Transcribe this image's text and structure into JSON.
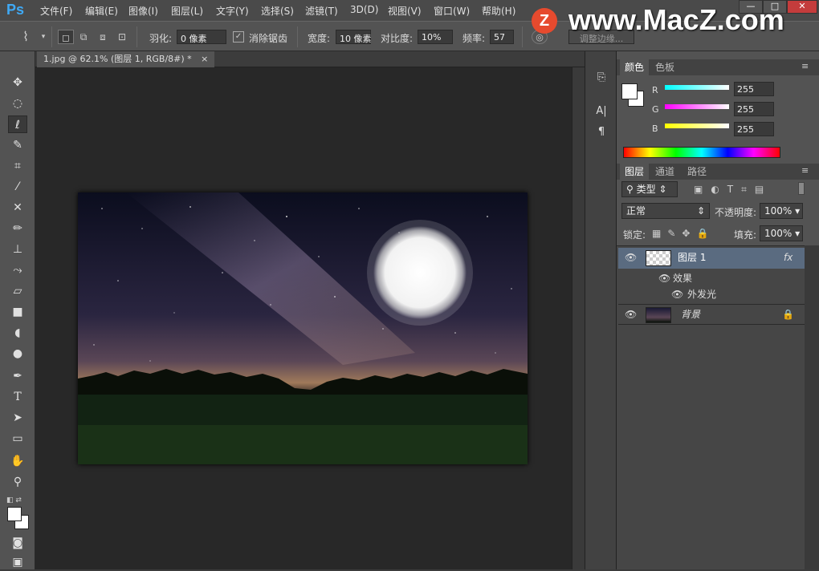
{
  "app": {
    "logo": "Ps"
  },
  "menu": [
    "文件(F)",
    "编辑(E)",
    "图像(I)",
    "图层(L)",
    "文字(Y)",
    "选择(S)",
    "滤镜(T)",
    "3D(D)",
    "视图(V)",
    "窗口(W)",
    "帮助(H)"
  ],
  "window_buttons": [
    "—",
    "□",
    "✕"
  ],
  "watermark": {
    "badge": "Z",
    "text": "www.MacZ.com"
  },
  "options": {
    "feather_label": "羽化:",
    "feather_value": "0 像素",
    "antialias_label": "消除锯齿",
    "antialias_checked": true,
    "width_label": "宽度:",
    "width_value": "10 像素",
    "contrast_label": "对比度:",
    "contrast_value": "10%",
    "frequency_label": "频率:",
    "frequency_value": "57",
    "refine_edge_label": "调整边缘..."
  },
  "document_tab": {
    "title": "1.jpg @ 62.1% (图层 1, RGB/8#) *",
    "close": "×"
  },
  "color_panel": {
    "tabs": [
      "颜色",
      "色板"
    ],
    "channels": [
      {
        "label": "R",
        "value": "255",
        "color": "#ff0000"
      },
      {
        "label": "G",
        "value": "255",
        "color": "#00ff00"
      },
      {
        "label": "B",
        "value": "255",
        "color": "#0000ff"
      }
    ]
  },
  "layers_panel": {
    "tabs": [
      "图层",
      "通道",
      "路径"
    ],
    "kind_filter": "类型",
    "blend_mode": "正常",
    "opacity_label": "不透明度:",
    "opacity_value": "100%",
    "lock_label": "锁定:",
    "fill_label": "填充:",
    "fill_value": "100%",
    "layers": [
      {
        "name": "图层 1",
        "fx": "fx",
        "selected": true
      },
      {
        "name": "背景",
        "locked": true
      }
    ],
    "effects_label": "效果",
    "effect_item": "外发光"
  }
}
